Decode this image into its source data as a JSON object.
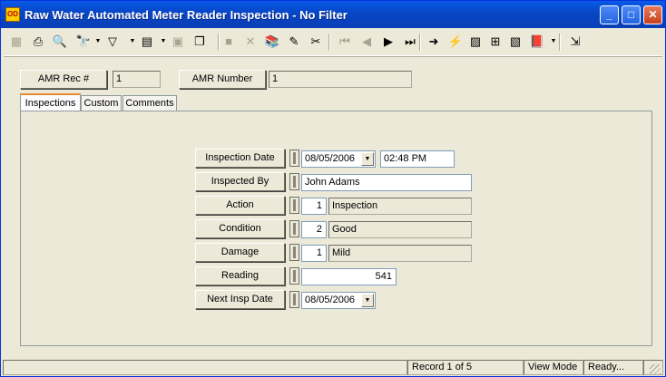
{
  "window": {
    "title": "Raw Water Automated Meter Reader Inspection - No Filter",
    "app_icon_text": "OD"
  },
  "title_buttons": {
    "minimize": "_",
    "maximize": "□",
    "close": "✕"
  },
  "toolbar": {
    "icons": [
      {
        "name": "new-record-icon",
        "glyph": "▦",
        "enabled": false
      },
      {
        "name": "print-icon",
        "glyph": "⎙",
        "enabled": true
      },
      {
        "name": "print-preview-icon",
        "glyph": "🔍",
        "enabled": true
      },
      {
        "name": "find-icon",
        "glyph": "🔭",
        "enabled": true
      },
      {
        "name": "filter-icon",
        "glyph": "▽",
        "enabled": true
      },
      {
        "name": "report-icon",
        "glyph": "▤",
        "enabled": true
      },
      {
        "name": "copy-record-icon",
        "glyph": "▣",
        "enabled": false
      },
      {
        "name": "duplicate-icon",
        "glyph": "❐",
        "enabled": true
      },
      {
        "name": "save-icon",
        "glyph": "■",
        "enabled": false
      },
      {
        "name": "delete-icon",
        "glyph": "✕",
        "enabled": false
      },
      {
        "name": "books-icon",
        "glyph": "📚",
        "enabled": true
      },
      {
        "name": "edit-pencil-icon",
        "glyph": "✎",
        "enabled": true
      },
      {
        "name": "cut-icon",
        "glyph": "✂",
        "enabled": true
      },
      {
        "name": "first-record-icon",
        "glyph": "⏮",
        "enabled": false
      },
      {
        "name": "previous-record-icon",
        "glyph": "◀",
        "enabled": false
      },
      {
        "name": "next-record-icon",
        "glyph": "▶",
        "enabled": true
      },
      {
        "name": "last-record-icon",
        "glyph": "⏭",
        "enabled": true
      },
      {
        "name": "goto-arrow-icon",
        "glyph": "➜",
        "enabled": true
      },
      {
        "name": "lightning-icon",
        "glyph": "⚡",
        "enabled": true
      },
      {
        "name": "dashboard-icon",
        "glyph": "▨",
        "enabled": true
      },
      {
        "name": "network-icon",
        "glyph": "⊞",
        "enabled": true
      },
      {
        "name": "map-icon",
        "glyph": "▧",
        "enabled": true
      },
      {
        "name": "library-icon",
        "glyph": "📕",
        "enabled": true
      },
      {
        "name": "exit-icon",
        "glyph": "⇲",
        "enabled": true
      }
    ]
  },
  "header": {
    "amr_rec_label": "AMR Rec #",
    "amr_rec_value": "1",
    "amr_number_label": "AMR Number",
    "amr_number_value": "1"
  },
  "tabs": [
    {
      "label": "Inspections",
      "active": true
    },
    {
      "label": "Custom",
      "active": false
    },
    {
      "label": "Comments",
      "active": false
    }
  ],
  "form": {
    "inspection_date_label": "Inspection Date",
    "inspection_date": "08/05/2006",
    "inspection_time": "02:48 PM",
    "inspected_by_label": "Inspected By",
    "inspected_by": "John Adams",
    "action_label": "Action",
    "action_code": "1",
    "action_desc": "Inspection",
    "condition_label": "Condition",
    "condition_code": "2",
    "condition_desc": "Good",
    "damage_label": "Damage",
    "damage_code": "1",
    "damage_desc": "Mild",
    "reading_label": "Reading",
    "reading": "541",
    "next_insp_date_label": "Next Insp Date",
    "next_insp_date": "08/05/2006"
  },
  "status": {
    "record": "Record 1 of 5",
    "mode": "View Mode",
    "state": "Ready..."
  }
}
